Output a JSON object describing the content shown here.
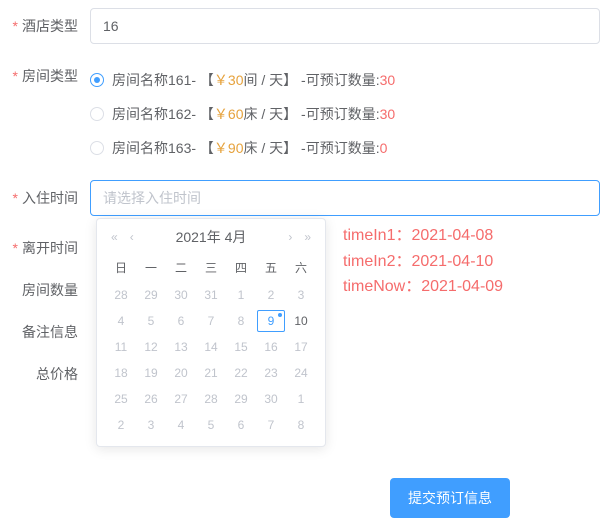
{
  "labels": {
    "hotelType": "酒店类型",
    "roomType": "房间类型",
    "checkin": "入住时间",
    "checkout": "离开时间",
    "roomQty": "房间数量",
    "remarks": "备注信息",
    "total": "总价格"
  },
  "hotelTypeValue": "16",
  "checkinPlaceholder": "请选择入住时间",
  "rooms": [
    {
      "name": "房间名称161",
      "openBracket": " - 【 ",
      "price": "￥30",
      "unit": " 间 / 天 ",
      "closeBracket": "】 - ",
      "availLabel": "可预订数量: ",
      "qty": "30",
      "checked": true
    },
    {
      "name": "房间名称162",
      "openBracket": " - 【 ",
      "price": "￥60",
      "unit": " 床 / 天 ",
      "closeBracket": "】 - ",
      "availLabel": "可预订数量: ",
      "qty": "30",
      "checked": false
    },
    {
      "name": "房间名称163",
      "openBracket": " - 【 ",
      "price": "￥90",
      "unit": " 床 / 天 ",
      "closeBracket": "】 - ",
      "availLabel": "可预订数量: ",
      "qty": "0",
      "checked": false
    }
  ],
  "calendar": {
    "title": "2021年 4月",
    "arrows": {
      "first": "«",
      "prev": "‹",
      "next": "›",
      "last": "»"
    },
    "dow": [
      "日",
      "一",
      "二",
      "三",
      "四",
      "五",
      "六"
    ],
    "cells": [
      {
        "d": "28",
        "o": true
      },
      {
        "d": "29",
        "o": true
      },
      {
        "d": "30",
        "o": true
      },
      {
        "d": "31",
        "o": true
      },
      {
        "d": "1"
      },
      {
        "d": "2"
      },
      {
        "d": "3"
      },
      {
        "d": "4"
      },
      {
        "d": "5"
      },
      {
        "d": "6"
      },
      {
        "d": "7"
      },
      {
        "d": "8"
      },
      {
        "d": "9",
        "today": true,
        "dot": true
      },
      {
        "d": "10",
        "avail": true
      },
      {
        "d": "11"
      },
      {
        "d": "12"
      },
      {
        "d": "13"
      },
      {
        "d": "14"
      },
      {
        "d": "15"
      },
      {
        "d": "16"
      },
      {
        "d": "17"
      },
      {
        "d": "18"
      },
      {
        "d": "19"
      },
      {
        "d": "20"
      },
      {
        "d": "21"
      },
      {
        "d": "22"
      },
      {
        "d": "23"
      },
      {
        "d": "24"
      },
      {
        "d": "25"
      },
      {
        "d": "26"
      },
      {
        "d": "27"
      },
      {
        "d": "28"
      },
      {
        "d": "29"
      },
      {
        "d": "30"
      },
      {
        "d": "1",
        "o": true
      },
      {
        "d": "2",
        "o": true
      },
      {
        "d": "3",
        "o": true
      },
      {
        "d": "4",
        "o": true
      },
      {
        "d": "5",
        "o": true
      },
      {
        "d": "6",
        "o": true
      },
      {
        "d": "7",
        "o": true
      },
      {
        "d": "8",
        "o": true
      }
    ]
  },
  "overlay": {
    "line1": "timeIn1：2021-04-08",
    "line2": "timeIn2：2021-04-10",
    "line3": "timeNow：2021-04-09"
  },
  "submitLabel": "提交预订信息"
}
